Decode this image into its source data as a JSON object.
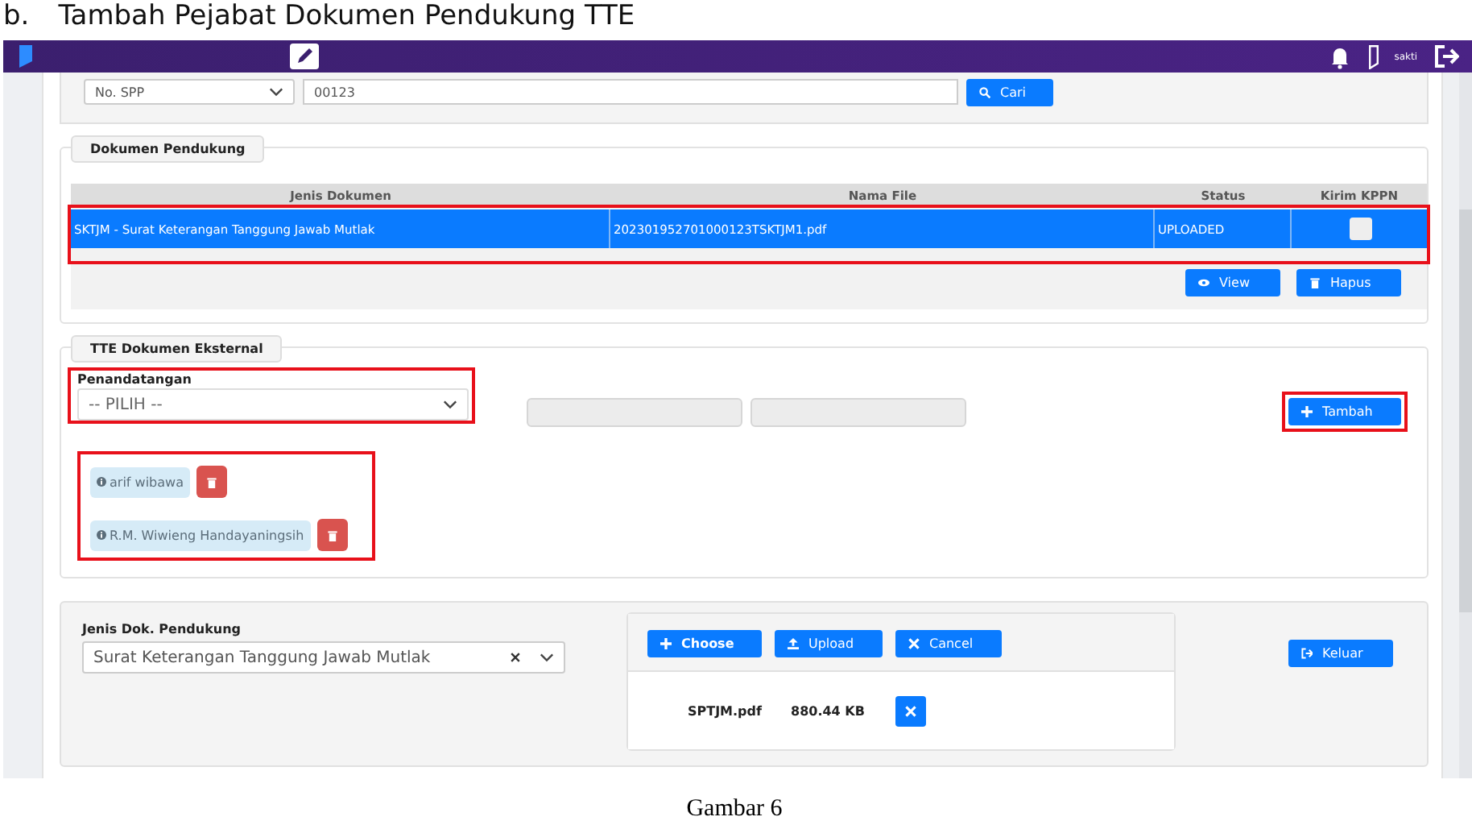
{
  "heading": {
    "marker": "b.",
    "title": "Tambah Pejabat Dokumen Pendukung TTE"
  },
  "app": {
    "header": {
      "user_label": "sakti"
    },
    "search": {
      "field": "No. SPP",
      "value": "00123",
      "button": "Cari"
    },
    "dokumen_pendukung": {
      "legend": "Dokumen Pendukung",
      "table": {
        "columns": [
          "Jenis Dokumen",
          "Nama File",
          "Status",
          "Kirim KPPN"
        ],
        "rows": [
          {
            "cells": [
              "SKTJM - Surat Keterangan Tanggung Jawab Mutlak",
              "202301952701000123TSKTJM1.pdf",
              "UPLOADED"
            ],
            "kirim_kppn": false,
            "selected": true,
            "highlighted": true
          }
        ]
      },
      "buttons": [
        {
          "label": "View",
          "kind": "view"
        },
        {
          "label": "Hapus",
          "kind": "delete"
        }
      ]
    },
    "tte": {
      "legend": "TTE Dokumen Eksternal",
      "signer_label": "Penandatangan",
      "signer_placeholder": "-- PILIH --",
      "signer_highlighted": true,
      "add_button": "Tambah",
      "add_highlighted": true,
      "signers_highlighted": true,
      "signers": [
        {
          "name": "arif wibawa"
        },
        {
          "name": "R.M. Wiwieng Handayaningsih"
        }
      ]
    },
    "upload": {
      "label": "Jenis Dok. Pendukung",
      "value": "Surat Keterangan Tanggung Jawab Mutlak",
      "buttons": [
        {
          "label": "Choose",
          "kind": "choose"
        },
        {
          "label": "Upload",
          "kind": "upload"
        },
        {
          "label": "Cancel",
          "kind": "cancel"
        }
      ],
      "files": [
        {
          "name": "SPTJM.pdf",
          "size": "880.44 KB"
        }
      ],
      "exit_button": "Keluar"
    }
  },
  "caption": "Gambar 6"
}
